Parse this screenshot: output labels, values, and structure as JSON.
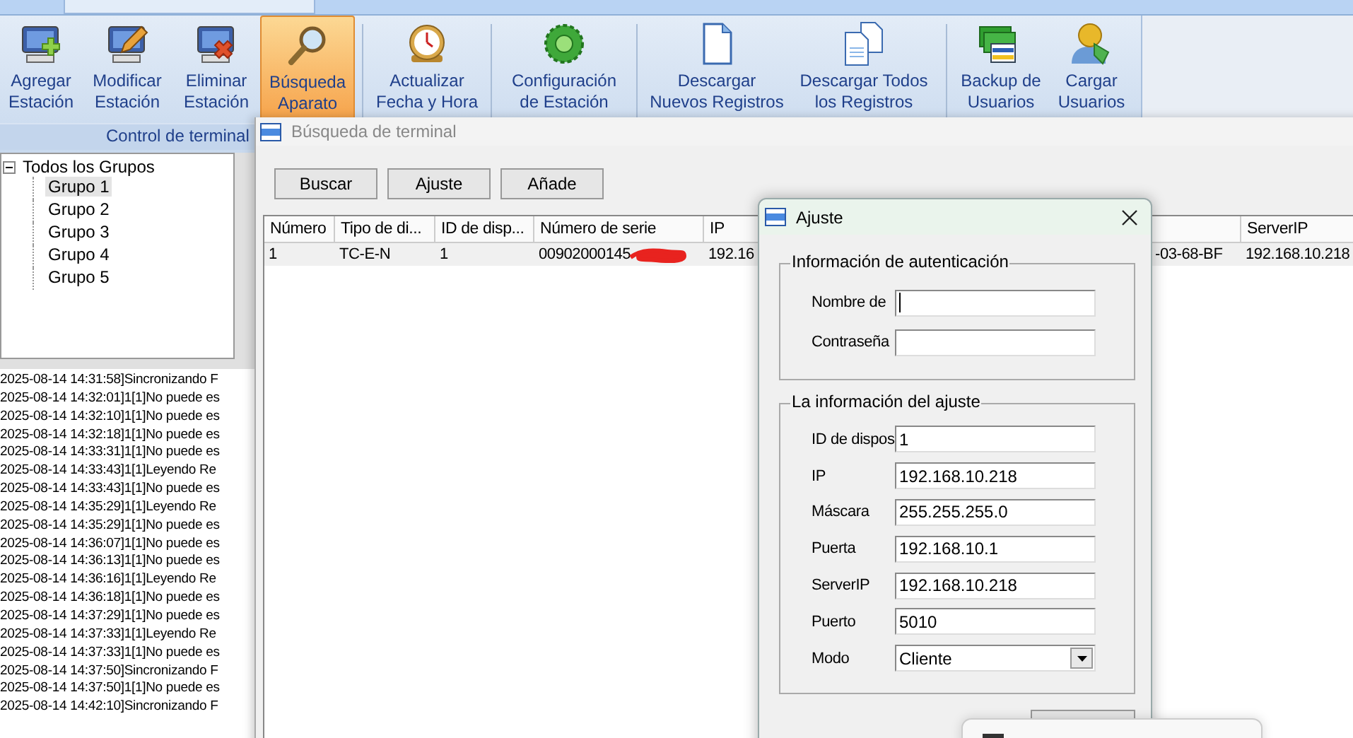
{
  "ribbon": {
    "buttons": [
      {
        "label_lines": [
          "Agregar",
          "Estación"
        ],
        "selected": false
      },
      {
        "label_lines": [
          "Modificar",
          "Estación"
        ],
        "selected": false
      },
      {
        "label_lines": [
          "Eliminar",
          "Estación"
        ],
        "selected": false
      },
      {
        "label_lines": [
          "Búsqueda",
          "Aparato"
        ],
        "selected": true
      },
      {
        "label_lines": [
          "Actualizar",
          "Fecha y Hora"
        ],
        "selected": false
      },
      {
        "label_lines": [
          "Configuración",
          "de Estación"
        ],
        "selected": false
      },
      {
        "label_lines": [
          "Descargar",
          "Nuevos Registros"
        ],
        "selected": false
      },
      {
        "label_lines": [
          "Descargar Todos",
          "los Registros"
        ],
        "selected": false
      },
      {
        "label_lines": [
          "Backup de",
          "Usuarios"
        ],
        "selected": false
      },
      {
        "label_lines": [
          "Cargar",
          "Usuarios"
        ],
        "selected": false
      }
    ],
    "group_label": "Control de terminal"
  },
  "tree": {
    "label": "Todos los Grupos",
    "expanded": true,
    "children": [
      {
        "label": "Grupo 1",
        "selected": true
      },
      {
        "label": "Grupo 2",
        "selected": false
      },
      {
        "label": "Grupo 3",
        "selected": false
      },
      {
        "label": "Grupo 4",
        "selected": false
      },
      {
        "label": "Grupo 5",
        "selected": false
      }
    ]
  },
  "log": {
    "lines": [
      "2025-08-14 14:31:58]Sincronizando F",
      "2025-08-14 14:32:01]1[1]No puede es",
      "2025-08-14 14:32:10]1[1]No puede es",
      "2025-08-14 14:32:18]1[1]No puede es",
      "2025-08-14 14:33:31]1[1]No puede es",
      "2025-08-14 14:33:43]1[1]Leyendo Re",
      "2025-08-14 14:33:43]1[1]No puede es",
      "2025-08-14 14:35:29]1[1]Leyendo Re",
      "2025-08-14 14:35:29]1[1]No puede es",
      "2025-08-14 14:36:07]1[1]No puede es",
      "2025-08-14 14:36:13]1[1]No puede es",
      "2025-08-14 14:36:16]1[1]Leyendo Re",
      "2025-08-14 14:36:18]1[1]No puede es",
      "2025-08-14 14:37:29]1[1]No puede es",
      "2025-08-14 14:37:33]1[1]Leyendo Re",
      "2025-08-14 14:37:33]1[1]No puede es",
      "2025-08-14 14:37:50]Sincronizando F",
      "2025-08-14 14:37:50]1[1]No puede es",
      "2025-08-14 14:42:10]Sincronizando F"
    ]
  },
  "search_window": {
    "title": "Búsqueda de terminal",
    "buttons": [
      "Buscar",
      "Ajuste",
      "Añade"
    ],
    "table": {
      "columns": [
        {
          "label": "Número"
        },
        {
          "label": "Tipo de di..."
        },
        {
          "label": "ID de disp..."
        },
        {
          "label": "Número de serie"
        },
        {
          "label": "IP"
        },
        {},
        {
          "label": "ServerIP"
        }
      ],
      "rows": [
        {
          "cells": [
            "1",
            "TC-E-N",
            "1",
            "00902000145",
            "192.16",
            "-03-68-BF",
            "192.168.10.218"
          ],
          "selected": true,
          "redacted": true
        }
      ]
    }
  },
  "dialog": {
    "title": "Ajuste",
    "groups": [
      {
        "legend": "Información de autenticación",
        "fields": [
          {
            "label": "Nombre de",
            "kind": "text",
            "focused": true
          },
          {
            "label": "Contraseña",
            "kind": "text"
          }
        ]
      },
      {
        "legend": "La información del ajuste",
        "fields": [
          {
            "label": "ID de dispos",
            "kind": "text",
            "value": "1"
          },
          {
            "label": "IP",
            "kind": "text",
            "value": "192.168.10.218"
          },
          {
            "label": "Máscara",
            "kind": "text",
            "value": "255.255.255.0"
          },
          {
            "label": "Puerta",
            "kind": "text",
            "value": "192.168.10.1"
          },
          {
            "label": "ServerIP",
            "kind": "text",
            "value": "192.168.10.218"
          },
          {
            "label": "Puerto",
            "kind": "text",
            "value": "5010"
          },
          {
            "label": "Modo",
            "kind": "select",
            "value": "Cliente"
          }
        ]
      }
    ]
  }
}
